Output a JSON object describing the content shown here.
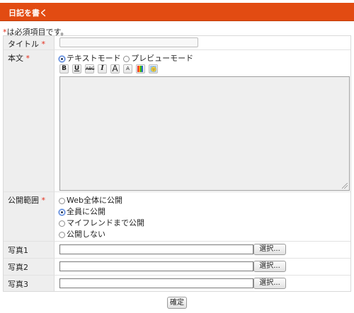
{
  "header": {
    "title": "日記を書く"
  },
  "note": {
    "asterisk": "*",
    "text": "は必須項目です。"
  },
  "fields": {
    "title_label": "タイトル",
    "body_label": "本文",
    "visibility_label": "公開範囲",
    "required_mark": "*",
    "photo1_label": "写真1",
    "photo2_label": "写真2",
    "photo3_label": "写真3"
  },
  "editor": {
    "mode_text": "テキストモード",
    "mode_preview": "プレビューモード",
    "selected_mode": "テキストモード",
    "toolbar": {
      "bold": "B",
      "underline": "U",
      "strike": "ABC",
      "italic": "I",
      "big": "A",
      "small": "A"
    }
  },
  "visibility": {
    "options": [
      "Web全体に公開",
      "全員に公開",
      "マイフレンドまで公開",
      "公開しない"
    ],
    "selected": "全員に公開"
  },
  "photos": {
    "choose_button": "選択..."
  },
  "submit": {
    "label": "確定"
  },
  "colors": {
    "header": "#e24b12",
    "required": "#e32b19",
    "label_bg": "#eeeeee"
  }
}
